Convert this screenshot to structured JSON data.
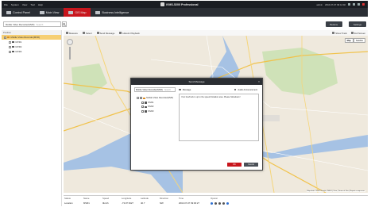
{
  "app": {
    "title": "iVMS-5200 Professional",
    "menus": [
      "File",
      "System",
      "View",
      "Tool",
      "Help"
    ],
    "user": "admin",
    "datetime": "2016-07-07 09:14:02"
  },
  "tabs": [
    {
      "label": "Control Panel",
      "active": false
    },
    {
      "label": "Main View",
      "active": false
    },
    {
      "label": "GIS Map",
      "active": true
    },
    {
      "label": "Business Intelligence",
      "active": false
    }
  ],
  "toolbar": {
    "combo_value": "Mobile Video Recorder(MVR)",
    "search_placeholder": "Search",
    "btn_buttons": "Buttons",
    "btn_settings": "Settings"
  },
  "left_panel": {
    "header": "Position",
    "root": "Mobile Video Recorder(MVR)",
    "children": [
      "MVR1",
      "MVR2",
      "MVR3"
    ]
  },
  "map_toolbar": {
    "items": [
      "Measure",
      "Select",
      "Send Message",
      "Historic Playback"
    ],
    "right_items": [
      "Show Track",
      "Full Screen"
    ]
  },
  "map": {
    "types": [
      "Map",
      "Satellite"
    ],
    "selected_type": "Map",
    "footer": "Map data ©2016 Google, INEGI | 5 km | Terms of Use | Report a map error"
  },
  "dialog": {
    "title": "Send Message",
    "combo_value": "Mobile Video Recorder(MVR)",
    "search_placeholder": "Search",
    "tree_root": "Mobile Video Recorder(MVR)",
    "tree_children": [
      "MVR1",
      "MVR2",
      "MVR3"
    ],
    "option_message": "Message",
    "option_audio": "Audio Announcement",
    "message_text": "Your bus/truck is up to the speed limitation area. Please Slowdown!",
    "ok_label": "OK",
    "cancel_label": "Cancel"
  },
  "status_table": {
    "headers": [
      "Status",
      "Name",
      "Speed",
      "Longitude",
      "Latitude",
      "Direction",
      "Time",
      "Operat"
    ],
    "row": [
      "Location",
      "MVR1",
      "0km/h",
      "-73.97 6327",
      "40.7 ",
      "NW",
      "2016-07-07 09:00:27"
    ]
  },
  "colors": {
    "accent_red": "#c8161d",
    "tab_bg": "#2a2e34",
    "selected_tree": "#f6cf74",
    "map_water": "#a6c2e4",
    "map_land": "#efe9dd"
  }
}
